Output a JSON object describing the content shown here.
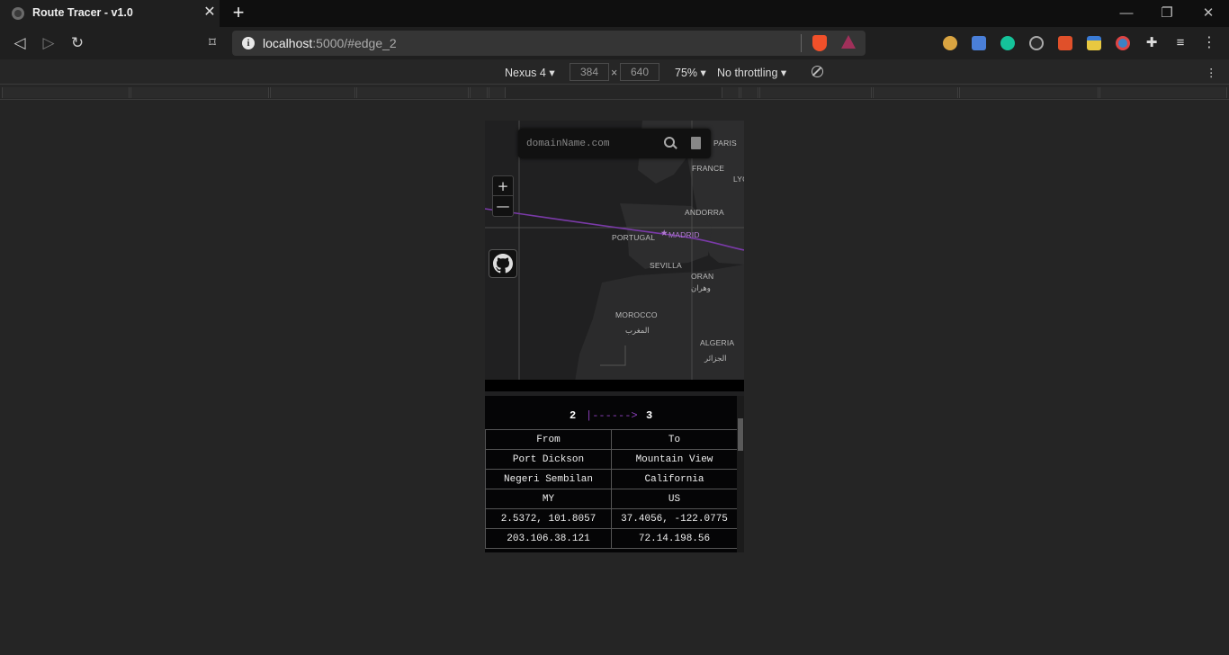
{
  "browser": {
    "tab_title": "Route Tracer - v1.0",
    "url_host": "localhost",
    "url_path": ":5000/#edge_2"
  },
  "devtools": {
    "device": "Nexus 4",
    "width": "384",
    "height": "640",
    "times": "×",
    "zoom": "75%",
    "throttling": "No throttling"
  },
  "map": {
    "search_placeholder": "domainName.com",
    "zoom_in": "+",
    "zoom_out": "—",
    "labels": {
      "paris": "PARIS",
      "france": "FRANCE",
      "lyon": "LYO",
      "andorra": "ANDORRA",
      "portugal": "PORTUGAL",
      "madrid": "MADRID",
      "sevilla": "SEVILLA",
      "oran": "ORAN",
      "oran_ar": "وهران",
      "morocco": "MOROCCO",
      "morocco_ar": "المغرب",
      "algeria": "ALGERIA",
      "algeria_ar": "الجزائر"
    },
    "route_color": "#7a3aa8"
  },
  "edge": {
    "from_hop": "2",
    "arrow": "|------>",
    "to_hop": "3",
    "headers": [
      "From",
      "To"
    ],
    "rows": [
      [
        "Port Dickson",
        "Mountain View"
      ],
      [
        "Negeri Sembilan",
        "California"
      ],
      [
        "MY",
        "US"
      ],
      [
        "2.5372, 101.8057",
        "37.4056, -122.0775"
      ],
      [
        "203.106.38.121",
        "72.14.198.56"
      ]
    ]
  }
}
